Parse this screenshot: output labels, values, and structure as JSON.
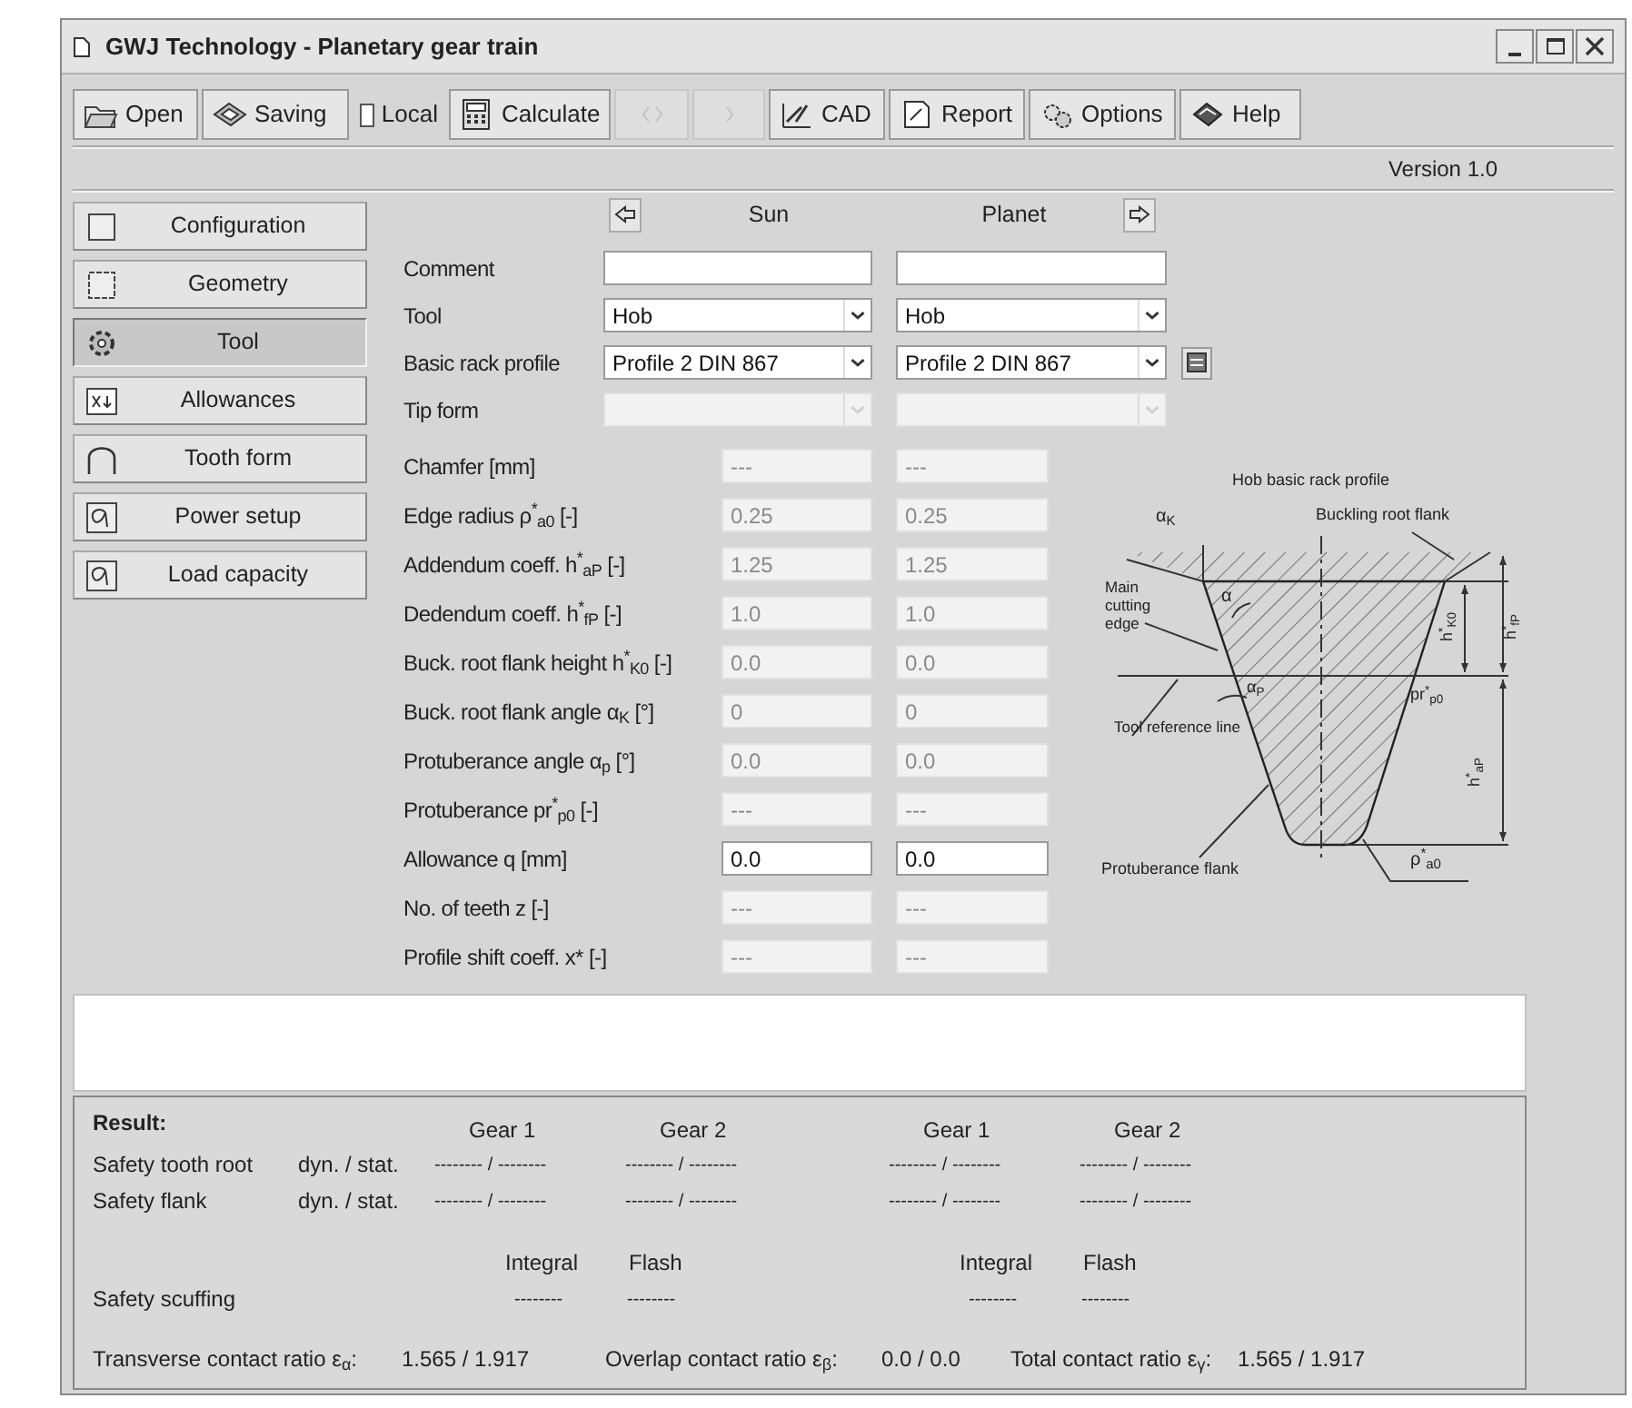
{
  "window": {
    "title": "GWJ Technology - Planetary gear train"
  },
  "toolbar": [
    {
      "kind": "button",
      "label": "Open",
      "disabled": false
    },
    {
      "kind": "button",
      "label": "Saving",
      "disabled": false
    },
    {
      "kind": "checkbox",
      "label": "Local",
      "checked": false
    },
    {
      "kind": "button",
      "label": "Calculate",
      "disabled": false
    },
    {
      "kind": "button",
      "disabled": true
    },
    {
      "kind": "button",
      "disabled": true
    },
    {
      "kind": "button",
      "label": "CAD",
      "disabled": false
    },
    {
      "kind": "button",
      "label": "Report",
      "disabled": false
    },
    {
      "kind": "button",
      "label": "Options",
      "disabled": false
    },
    {
      "kind": "button",
      "label": "Help",
      "disabled": false
    }
  ],
  "version": "Version 1.0",
  "nav": [
    {
      "label": "Configuration",
      "selected": false
    },
    {
      "label": "Geometry",
      "selected": false
    },
    {
      "label": "Tool",
      "selected": true
    },
    {
      "label": "Allowances",
      "selected": false
    },
    {
      "label": "Tooth form",
      "selected": false
    },
    {
      "label": "Power setup",
      "selected": false
    },
    {
      "label": "Load capacity",
      "selected": false
    }
  ],
  "form": {
    "columns": [
      "Sun",
      "Planet"
    ],
    "rows": [
      {
        "label": "Comment",
        "kind": "text",
        "cells": [
          {
            "disabled": false
          },
          {
            "disabled": false
          }
        ]
      },
      {
        "label": "Tool",
        "kind": "select",
        "cells": [
          {
            "value": "Hob",
            "disabled": false
          },
          {
            "value": "Hob",
            "disabled": false
          }
        ]
      },
      {
        "label": "Basic rack profile",
        "kind": "select",
        "library_button": true,
        "cells": [
          {
            "value": "Profile 2 DIN 867",
            "disabled": false
          },
          {
            "value": "Profile 2 DIN 867",
            "disabled": false
          }
        ]
      },
      {
        "label": "Tip form",
        "kind": "select",
        "cells": [
          {
            "disabled": true
          },
          {
            "disabled": true
          }
        ]
      },
      {
        "label": "Chamfer [mm]",
        "kind": "number",
        "cells": [
          {
            "value": "---",
            "disabled": true
          },
          {
            "value": "---",
            "disabled": true
          }
        ]
      },
      {
        "label": "Edge radius ρ$^{*}$$_{a0}$ [-]",
        "kind": "number",
        "cells": [
          {
            "value": "0.25",
            "disabled": true
          },
          {
            "value": "0.25",
            "disabled": true
          }
        ]
      },
      {
        "label": "Addendum coeff. h$^{*}$$_{aP}$ [-]",
        "kind": "number",
        "cells": [
          {
            "value": "1.25",
            "disabled": true
          },
          {
            "value": "1.25",
            "disabled": true
          }
        ]
      },
      {
        "label": "Dedendum coeff. h$^{*}$$_{fP}$ [-]",
        "kind": "number",
        "cells": [
          {
            "value": "1.0",
            "disabled": true
          },
          {
            "value": "1.0",
            "disabled": true
          }
        ]
      },
      {
        "label": "Buck. root flank height h$^{*}$$_{K0}$ [-]",
        "kind": "number",
        "cells": [
          {
            "value": "0.0",
            "disabled": true
          },
          {
            "value": "0.0",
            "disabled": true
          }
        ]
      },
      {
        "label": "Buck. root flank angle α$_{K}$ [°]",
        "kind": "number",
        "cells": [
          {
            "value": "0",
            "disabled": true
          },
          {
            "value": "0",
            "disabled": true
          }
        ]
      },
      {
        "label": "Protuberance angle α$_{p}$ [°]",
        "kind": "number",
        "cells": [
          {
            "value": "0.0",
            "disabled": true
          },
          {
            "value": "0.0",
            "disabled": true
          }
        ]
      },
      {
        "label": "Protuberance pr$^{*}$$_{p0}$ [-]",
        "kind": "number",
        "cells": [
          {
            "value": "---",
            "disabled": true
          },
          {
            "value": "---",
            "disabled": true
          }
        ]
      },
      {
        "label": "Allowance q [mm]",
        "kind": "number",
        "cells": [
          {
            "value": "0.0",
            "disabled": false
          },
          {
            "value": "0.0",
            "disabled": false
          }
        ]
      },
      {
        "label": "No. of teeth z [-]",
        "kind": "number",
        "cells": [
          {
            "value": "---",
            "disabled": true
          },
          {
            "value": "---",
            "disabled": true
          }
        ]
      },
      {
        "label": "Profile shift coeff. x* [-]",
        "kind": "number",
        "cells": [
          {
            "value": "---",
            "disabled": true
          },
          {
            "value": "---",
            "disabled": true
          }
        ]
      }
    ]
  },
  "diagram": {
    "title": "Hob basic rack profile",
    "labels": [
      "α$_{K}$",
      "Buckling root flank",
      "Main cutting edge",
      "α",
      "h$^{*}$$_{K0}$",
      "h$^{*}$$_{fP}$",
      "α$_{P}$",
      "pr$^{*}$$_{p0}$",
      "Tool reference line",
      "h$^{*}$$_{aP}$",
      "Protuberance flank",
      "ρ$^{*}$$_{a0}$"
    ]
  },
  "results": {
    "title": "Result:",
    "headers": [
      "Gear 1",
      "Gear 2",
      "Gear 1",
      "Gear 2"
    ],
    "rows": [
      {
        "label": "Safety tooth root",
        "unit": "dyn. / stat.",
        "values": [
          "-------- / --------",
          "-------- / --------",
          "-------- / --------",
          "-------- / --------"
        ]
      },
      {
        "label": "Safety flank",
        "unit": "dyn. / stat.",
        "values": [
          "-------- / --------",
          "-------- / --------",
          "-------- / --------",
          "-------- / --------"
        ]
      }
    ],
    "scuffing_headers": [
      "Integral",
      "Flash",
      "Integral",
      "Flash"
    ],
    "scuffing": {
      "label": "Safety scuffing",
      "values": [
        "--------",
        "--------",
        "--------",
        "--------"
      ]
    },
    "contact_ratios": [
      {
        "label": "Transverse contact ratio ε$_{α}$:",
        "value": "1.565 / 1.917"
      },
      {
        "label": "Overlap contact ratio ε$_{β}$:",
        "value": "0.0 / 0.0"
      },
      {
        "label": "Total contact ratio ε$_{γ}$:",
        "value": "1.565 / 1.917"
      }
    ]
  }
}
